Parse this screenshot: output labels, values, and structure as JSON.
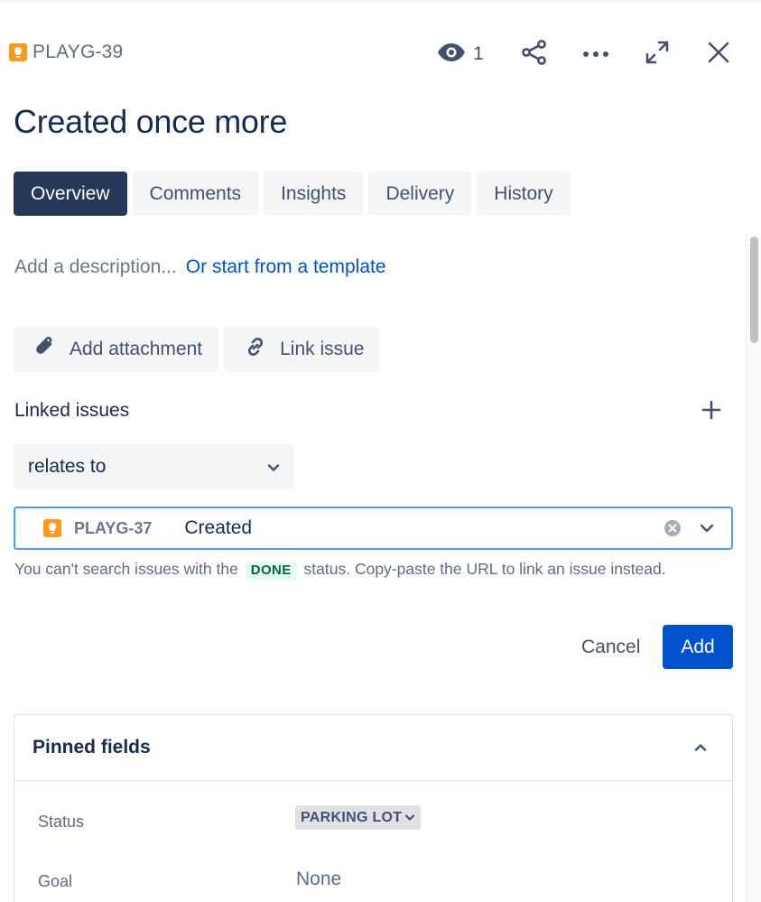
{
  "header": {
    "issue_key": "PLAYG-39",
    "watch_count": "1",
    "icons": {
      "issue_type": "idea-lightbulb-icon",
      "watch": "eye-icon",
      "share": "share-icon",
      "more": "more-horizontal-icon",
      "expand": "expand-icon",
      "close": "close-icon"
    }
  },
  "title": "Created once more",
  "tabs": [
    {
      "label": "Overview",
      "active": true
    },
    {
      "label": "Comments",
      "active": false
    },
    {
      "label": "Insights",
      "active": false
    },
    {
      "label": "Delivery",
      "active": false
    },
    {
      "label": "History",
      "active": false
    }
  ],
  "description": {
    "placeholder": "Add a description...",
    "template_link": "Or start from a template"
  },
  "actions": {
    "add_attachment": "Add attachment",
    "link_issue": "Link issue"
  },
  "linked_issues": {
    "label": "Linked issues",
    "relation": "relates to",
    "selected_key": "PLAYG-37",
    "selected_summary": "Created",
    "helper_before": "You can't search issues with the",
    "helper_status": "DONE",
    "helper_after": "status. Copy-paste the URL to link an issue instead.",
    "cancel_label": "Cancel",
    "add_label": "Add"
  },
  "pinned_fields": {
    "title": "Pinned fields",
    "fields": [
      {
        "label": "Status",
        "value": "PARKING LOT"
      },
      {
        "label": "Goal",
        "value": "None"
      }
    ]
  },
  "colors": {
    "primary": "#0052cc",
    "active_tab": "#253858",
    "idea_icon": "#ff991f",
    "focus_border": "#4c9aff",
    "done_lozenge_bg": "#e3fcef",
    "done_lozenge_text": "#006644"
  }
}
